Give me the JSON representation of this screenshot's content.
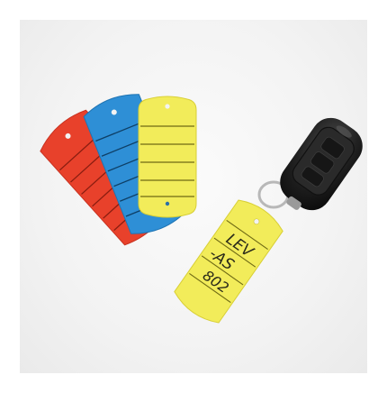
{
  "scene": {
    "background_color": "#f3f3f3",
    "tag_colors": {
      "red": "#e8412b",
      "blue": "#2e8fd6",
      "yellow": "#f2ec5a"
    },
    "car_key": {
      "body_color": "#1c1c1c",
      "ring_color": "#b8b8b8"
    },
    "tag_writing": {
      "line1": "LEV",
      "line2": "-AS",
      "line3": "802"
    }
  }
}
